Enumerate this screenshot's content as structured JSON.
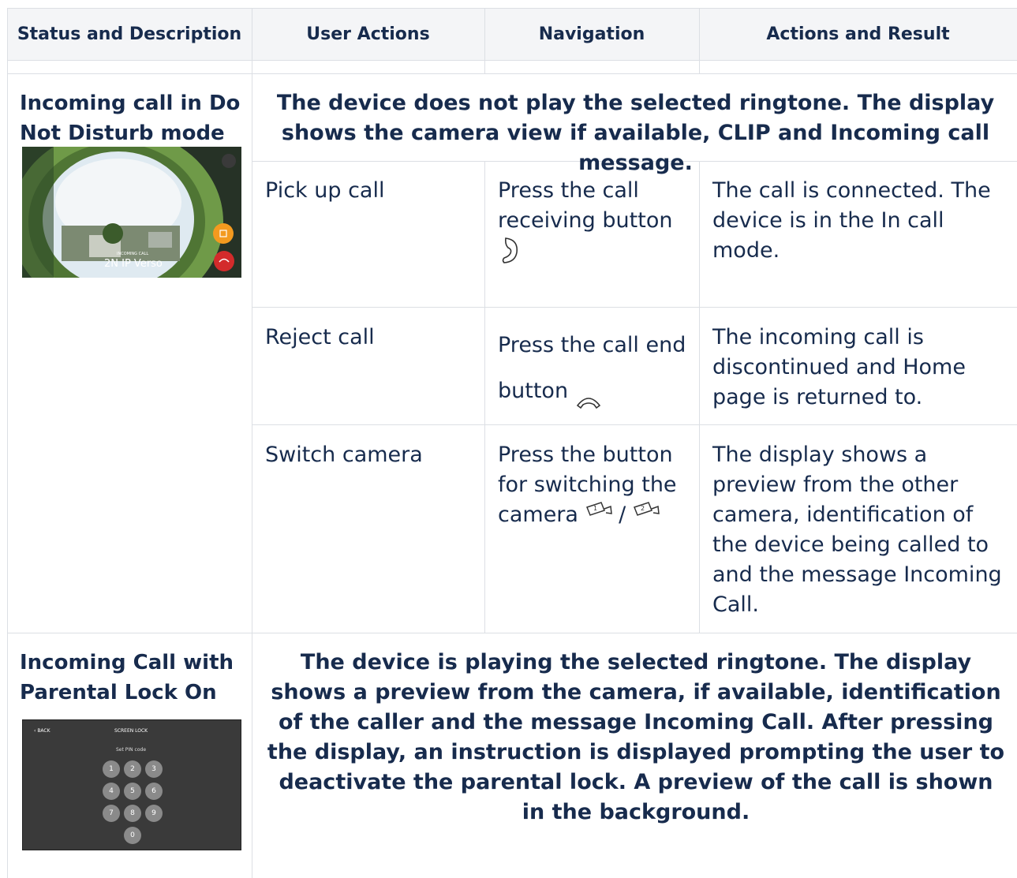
{
  "header": {
    "col1": "Status and Description",
    "col2": "User Actions",
    "col3": "Navigation",
    "col4": "Actions and Result"
  },
  "dnd": {
    "status": "Incoming call in Do Not Disturb mode",
    "description": "The device does not play the selected ringtone. The display shows the camera view if available, CLIP and Incoming call message.",
    "screenshot": {
      "caller": "2N IP Verso",
      "incoming_label": "INCOMING CALL"
    },
    "rows": [
      {
        "action": "Pick up call",
        "navigation": "Press the call receiving button",
        "result": "The call is connected. The device is in the In call mode.",
        "icon": "phone-receive-icon"
      },
      {
        "action": "Reject call",
        "navigation": "Press the call end button",
        "result": "The incoming call is discontinued and Home page is returned to.",
        "icon": "phone-end-icon"
      },
      {
        "action": "Switch camera",
        "navigation": "Press the button for switching the camera",
        "separator": "/",
        "result": "The display shows a preview from the other camera, identification of the device being called to and the message Incoming Call.",
        "icons": [
          "camera-1-icon",
          "camera-2-icon"
        ]
      }
    ]
  },
  "parental": {
    "status": "Incoming Call with Parental Lock On",
    "description": "The device is playing the selected ringtone. The display shows a preview from the camera, if available, identification of the caller and the message Incoming Call. After pressing the display, an instruction is displayed prompting the user to deactivate the parental lock. A preview of the call is shown in the background.",
    "screenshot": {
      "back": "BACK",
      "title": "SCREEN LOCK",
      "prompt": "Set PIN code",
      "keys": [
        "1",
        "2",
        "3",
        "4",
        "5",
        "6",
        "7",
        "8",
        "9",
        "0"
      ]
    }
  }
}
